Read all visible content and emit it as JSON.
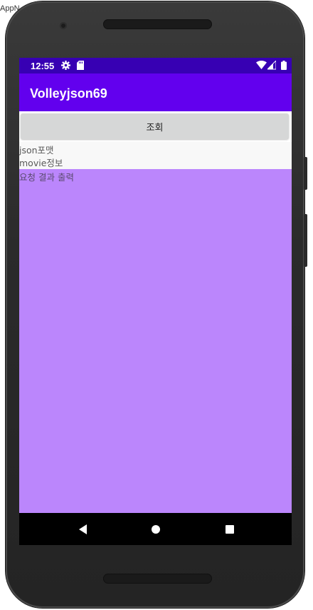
{
  "host": {
    "label": "AppN"
  },
  "status_bar": {
    "time": "12:55",
    "icons": [
      "gear-icon",
      "sd-card-icon",
      "wifi-icon",
      "signal-icon",
      "battery-icon"
    ]
  },
  "app_bar": {
    "title": "Volleyjson69"
  },
  "main": {
    "query_button_label": "조회",
    "input_lines": [
      "json포맷",
      "movie정보"
    ],
    "result_text": "요청 결과 출력"
  },
  "nav_bar": {
    "icons": [
      "back-icon",
      "home-icon",
      "recents-icon"
    ]
  },
  "colors": {
    "status_bar": "#3700b3",
    "app_bar": "#6200ee",
    "result_area": "#bb86fc",
    "button": "#d6d7d7"
  }
}
